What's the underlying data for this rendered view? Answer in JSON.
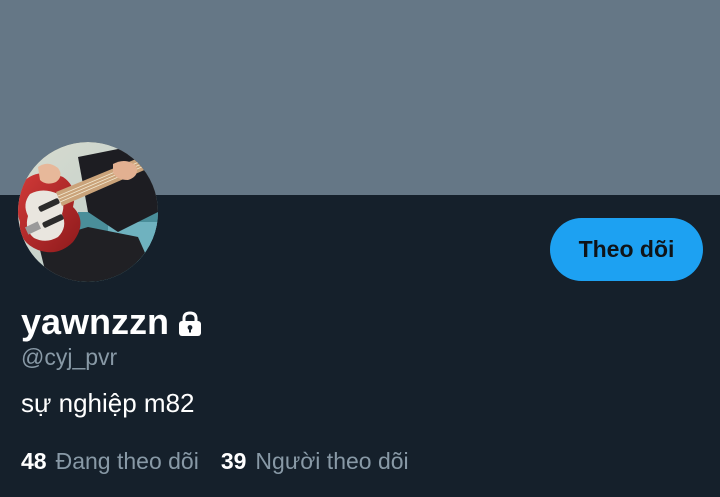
{
  "profile": {
    "display_name": "yawnzzn",
    "handle": "@cyj_pvr",
    "bio": "sự nghiệp m82",
    "protected_icon": "lock-icon",
    "avatar_description": "avatar-photo-bass-guitar"
  },
  "actions": {
    "follow_label": "Theo dõi"
  },
  "stats": {
    "following": {
      "count": "48",
      "label": "Đang theo dõi"
    },
    "followers": {
      "count": "39",
      "label": "Người theo dõi"
    }
  },
  "colors": {
    "background": "#15202b",
    "banner": "#657786",
    "accent": "#1da1f2",
    "secondary_text": "#8899a6",
    "primary_text": "#ffffff"
  }
}
